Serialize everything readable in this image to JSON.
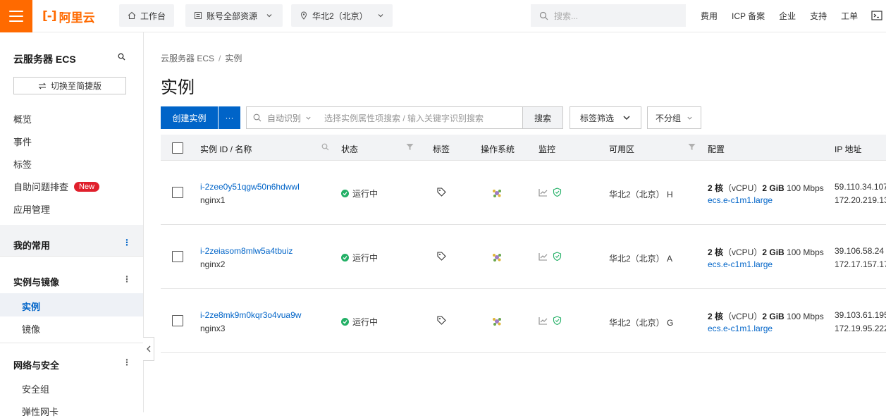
{
  "topbar": {
    "logo_text": "阿里云",
    "workbench": "工作台",
    "resources": "账号全部资源",
    "region": "华北2（北京）",
    "search_placeholder": "搜索...",
    "links": [
      "费用",
      "ICP 备案",
      "企业",
      "支持",
      "工单"
    ]
  },
  "sidebar": {
    "title": "云服务器 ECS",
    "switch_label": "切换至简捷版",
    "items": [
      "概览",
      "事件",
      "标签",
      "自助问题排查",
      "应用管理"
    ],
    "new_badge": "New",
    "section_favorites": "我的常用",
    "section_instances": "实例与镜像",
    "instances_sub": [
      "实例",
      "镜像"
    ],
    "section_network": "网络与安全",
    "network_sub": [
      "安全组",
      "弹性网卡"
    ]
  },
  "breadcrumb": {
    "root": "云服务器 ECS",
    "sep": "/",
    "current": "实例"
  },
  "page_title": "实例",
  "toolbar": {
    "create_label": "创建实例",
    "more_label": "···",
    "filter_select": "自动识别",
    "filter_placeholder": "选择实例属性项搜索 / 输入关键字识别搜索",
    "search_label": "搜索",
    "tag_filter_label": "标签筛选",
    "group_label": "不分组"
  },
  "table": {
    "headers": [
      "实例 ID / 名称",
      "状态",
      "标签",
      "操作系统",
      "监控",
      "可用区",
      "配置",
      "IP 地址"
    ],
    "rows": [
      {
        "id": "i-2zee0y51qgw50n6hdwwl",
        "name": "nginx1",
        "status": "运行中",
        "zone": "华北2（北京） H",
        "cfg_cores": "2 核",
        "cfg_vcpu": "（vCPU）",
        "cfg_mem": "2 GiB",
        "cfg_bw": "100 Mbps",
        "type": "ecs.e-c1m1.large",
        "ip_public": "59.110.34.107",
        "ip_private": "172.20.219.13"
      },
      {
        "id": "i-2zeiasom8mlw5a4tbuiz",
        "name": "nginx2",
        "status": "运行中",
        "zone": "华北2（北京） A",
        "cfg_cores": "2 核",
        "cfg_vcpu": "（vCPU）",
        "cfg_mem": "2 GiB",
        "cfg_bw": "100 Mbps",
        "type": "ecs.e-c1m1.large",
        "ip_public": "39.106.58.24",
        "ip_private": "172.17.157.17"
      },
      {
        "id": "i-2ze8mk9m0kqr3o4vua9w",
        "name": "nginx3",
        "status": "运行中",
        "zone": "华北2（北京） G",
        "cfg_cores": "2 核",
        "cfg_vcpu": "（vCPU）",
        "cfg_mem": "2 GiB",
        "cfg_bw": "100 Mbps",
        "type": "ecs.e-c1m1.large",
        "ip_public": "39.103.61.195",
        "ip_private": "172.19.95.222"
      }
    ]
  },
  "colors": {
    "brand": "#ff6a00",
    "primary": "#0064c8",
    "running": "#23b066",
    "new_badge": "#e0202c"
  }
}
